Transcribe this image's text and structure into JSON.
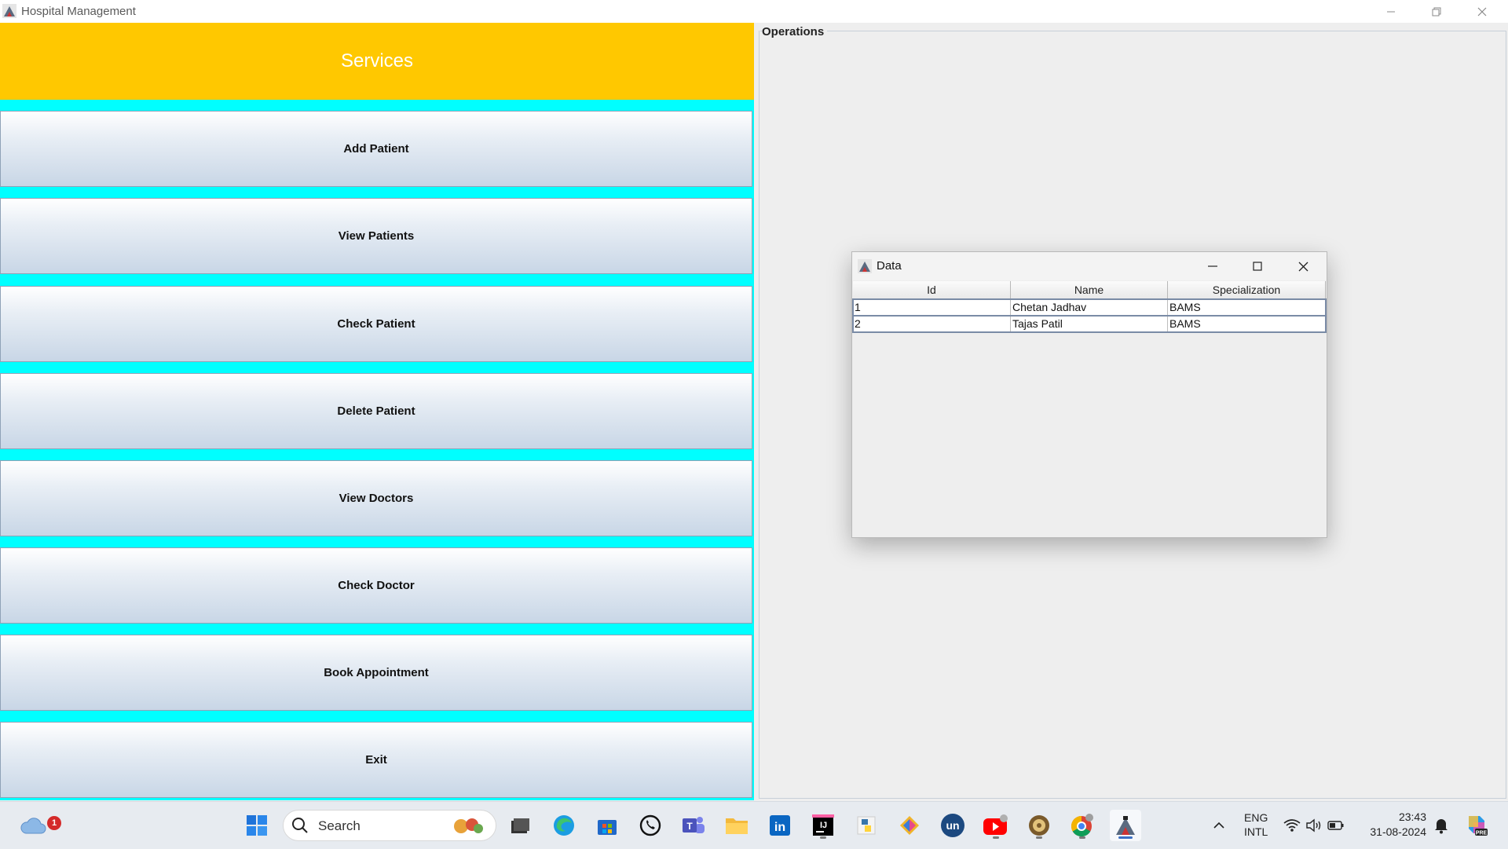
{
  "window": {
    "title": "Hospital Management"
  },
  "services": {
    "header": "Services",
    "buttons": [
      {
        "label": "Add Patient"
      },
      {
        "label": "View Patients"
      },
      {
        "label": "Check Patient"
      },
      {
        "label": "Delete Patient"
      },
      {
        "label": "View Doctors"
      },
      {
        "label": "Check Doctor"
      },
      {
        "label": "Book Appointment"
      },
      {
        "label": "Exit"
      }
    ]
  },
  "operations": {
    "label": "Operations"
  },
  "dialog": {
    "title": "Data",
    "columns": [
      "Id",
      "Name",
      "Specialization"
    ],
    "rows": [
      {
        "id": "1",
        "name": "Chetan Jadhav",
        "specialization": "BAMS"
      },
      {
        "id": "2",
        "name": "Tajas Patil",
        "specialization": "BAMS"
      }
    ]
  },
  "taskbar": {
    "weather_badge": "1",
    "search_placeholder": "Search",
    "language_line1": "ENG",
    "language_line2": "INTL",
    "time": "23:43",
    "date": "31-08-2024",
    "pinned_apps": [
      "start-icon",
      "search",
      "file-explorer-icon",
      "edge-icon",
      "store-icon",
      "whatsapp-icon",
      "teams-icon",
      "folder-icon",
      "linkedin-icon",
      "intellij-icon",
      "python-icon",
      "git-icon",
      "unstop-icon",
      "youtube-icon",
      "app-icon",
      "chrome-icon",
      "java-app-icon"
    ]
  },
  "colors": {
    "header_yellow": "#ffc800",
    "separator_cyan": "#00ffff",
    "button_gradient_top": "#ffffff",
    "button_gradient_bottom": "#c8d6e6"
  }
}
